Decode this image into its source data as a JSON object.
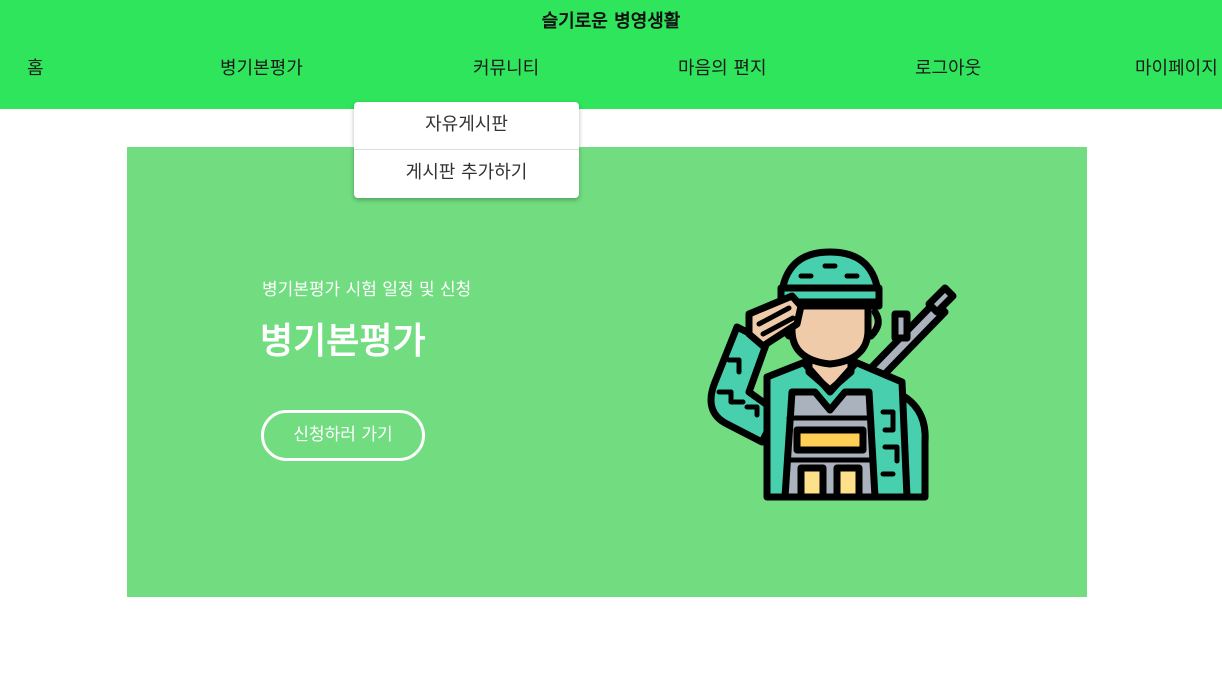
{
  "header": {
    "title": "슬기로운 병영생활",
    "nav": [
      {
        "label": "홈"
      },
      {
        "label": "병기본평가"
      },
      {
        "label": "커뮤니티"
      },
      {
        "label": "마음의 편지"
      },
      {
        "label": "로그아웃"
      },
      {
        "label": "마이페이지"
      }
    ]
  },
  "dropdown": {
    "items": [
      {
        "label": "자유게시판"
      },
      {
        "label": "게시판 추가하기"
      }
    ]
  },
  "banner": {
    "subtitle": "병기본평가 시험 일정 및 신청",
    "title": "병기본평가",
    "button_label": "신청하러 가기",
    "illustration_icon": "saluting-soldier-icon"
  },
  "colors": {
    "header_bg": "#2ee55c",
    "banner_bg": "#72dc81",
    "helmet": "#48cfad",
    "skin": "#f0cba9",
    "vest": "#aab2bd",
    "pouch": "#ffce54",
    "outline": "#000000"
  }
}
